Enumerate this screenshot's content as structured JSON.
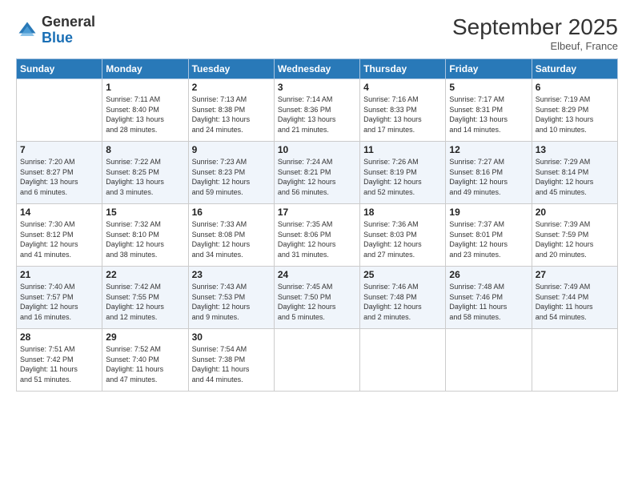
{
  "header": {
    "logo_general": "General",
    "logo_blue": "Blue",
    "month_title": "September 2025",
    "location": "Elbeuf, France"
  },
  "weekdays": [
    "Sunday",
    "Monday",
    "Tuesday",
    "Wednesday",
    "Thursday",
    "Friday",
    "Saturday"
  ],
  "weeks": [
    [
      {
        "day": "",
        "info": ""
      },
      {
        "day": "1",
        "info": "Sunrise: 7:11 AM\nSunset: 8:40 PM\nDaylight: 13 hours\nand 28 minutes."
      },
      {
        "day": "2",
        "info": "Sunrise: 7:13 AM\nSunset: 8:38 PM\nDaylight: 13 hours\nand 24 minutes."
      },
      {
        "day": "3",
        "info": "Sunrise: 7:14 AM\nSunset: 8:36 PM\nDaylight: 13 hours\nand 21 minutes."
      },
      {
        "day": "4",
        "info": "Sunrise: 7:16 AM\nSunset: 8:33 PM\nDaylight: 13 hours\nand 17 minutes."
      },
      {
        "day": "5",
        "info": "Sunrise: 7:17 AM\nSunset: 8:31 PM\nDaylight: 13 hours\nand 14 minutes."
      },
      {
        "day": "6",
        "info": "Sunrise: 7:19 AM\nSunset: 8:29 PM\nDaylight: 13 hours\nand 10 minutes."
      }
    ],
    [
      {
        "day": "7",
        "info": "Sunrise: 7:20 AM\nSunset: 8:27 PM\nDaylight: 13 hours\nand 6 minutes."
      },
      {
        "day": "8",
        "info": "Sunrise: 7:22 AM\nSunset: 8:25 PM\nDaylight: 13 hours\nand 3 minutes."
      },
      {
        "day": "9",
        "info": "Sunrise: 7:23 AM\nSunset: 8:23 PM\nDaylight: 12 hours\nand 59 minutes."
      },
      {
        "day": "10",
        "info": "Sunrise: 7:24 AM\nSunset: 8:21 PM\nDaylight: 12 hours\nand 56 minutes."
      },
      {
        "day": "11",
        "info": "Sunrise: 7:26 AM\nSunset: 8:19 PM\nDaylight: 12 hours\nand 52 minutes."
      },
      {
        "day": "12",
        "info": "Sunrise: 7:27 AM\nSunset: 8:16 PM\nDaylight: 12 hours\nand 49 minutes."
      },
      {
        "day": "13",
        "info": "Sunrise: 7:29 AM\nSunset: 8:14 PM\nDaylight: 12 hours\nand 45 minutes."
      }
    ],
    [
      {
        "day": "14",
        "info": "Sunrise: 7:30 AM\nSunset: 8:12 PM\nDaylight: 12 hours\nand 41 minutes."
      },
      {
        "day": "15",
        "info": "Sunrise: 7:32 AM\nSunset: 8:10 PM\nDaylight: 12 hours\nand 38 minutes."
      },
      {
        "day": "16",
        "info": "Sunrise: 7:33 AM\nSunset: 8:08 PM\nDaylight: 12 hours\nand 34 minutes."
      },
      {
        "day": "17",
        "info": "Sunrise: 7:35 AM\nSunset: 8:06 PM\nDaylight: 12 hours\nand 31 minutes."
      },
      {
        "day": "18",
        "info": "Sunrise: 7:36 AM\nSunset: 8:03 PM\nDaylight: 12 hours\nand 27 minutes."
      },
      {
        "day": "19",
        "info": "Sunrise: 7:37 AM\nSunset: 8:01 PM\nDaylight: 12 hours\nand 23 minutes."
      },
      {
        "day": "20",
        "info": "Sunrise: 7:39 AM\nSunset: 7:59 PM\nDaylight: 12 hours\nand 20 minutes."
      }
    ],
    [
      {
        "day": "21",
        "info": "Sunrise: 7:40 AM\nSunset: 7:57 PM\nDaylight: 12 hours\nand 16 minutes."
      },
      {
        "day": "22",
        "info": "Sunrise: 7:42 AM\nSunset: 7:55 PM\nDaylight: 12 hours\nand 12 minutes."
      },
      {
        "day": "23",
        "info": "Sunrise: 7:43 AM\nSunset: 7:53 PM\nDaylight: 12 hours\nand 9 minutes."
      },
      {
        "day": "24",
        "info": "Sunrise: 7:45 AM\nSunset: 7:50 PM\nDaylight: 12 hours\nand 5 minutes."
      },
      {
        "day": "25",
        "info": "Sunrise: 7:46 AM\nSunset: 7:48 PM\nDaylight: 12 hours\nand 2 minutes."
      },
      {
        "day": "26",
        "info": "Sunrise: 7:48 AM\nSunset: 7:46 PM\nDaylight: 11 hours\nand 58 minutes."
      },
      {
        "day": "27",
        "info": "Sunrise: 7:49 AM\nSunset: 7:44 PM\nDaylight: 11 hours\nand 54 minutes."
      }
    ],
    [
      {
        "day": "28",
        "info": "Sunrise: 7:51 AM\nSunset: 7:42 PM\nDaylight: 11 hours\nand 51 minutes."
      },
      {
        "day": "29",
        "info": "Sunrise: 7:52 AM\nSunset: 7:40 PM\nDaylight: 11 hours\nand 47 minutes."
      },
      {
        "day": "30",
        "info": "Sunrise: 7:54 AM\nSunset: 7:38 PM\nDaylight: 11 hours\nand 44 minutes."
      },
      {
        "day": "",
        "info": ""
      },
      {
        "day": "",
        "info": ""
      },
      {
        "day": "",
        "info": ""
      },
      {
        "day": "",
        "info": ""
      }
    ]
  ]
}
